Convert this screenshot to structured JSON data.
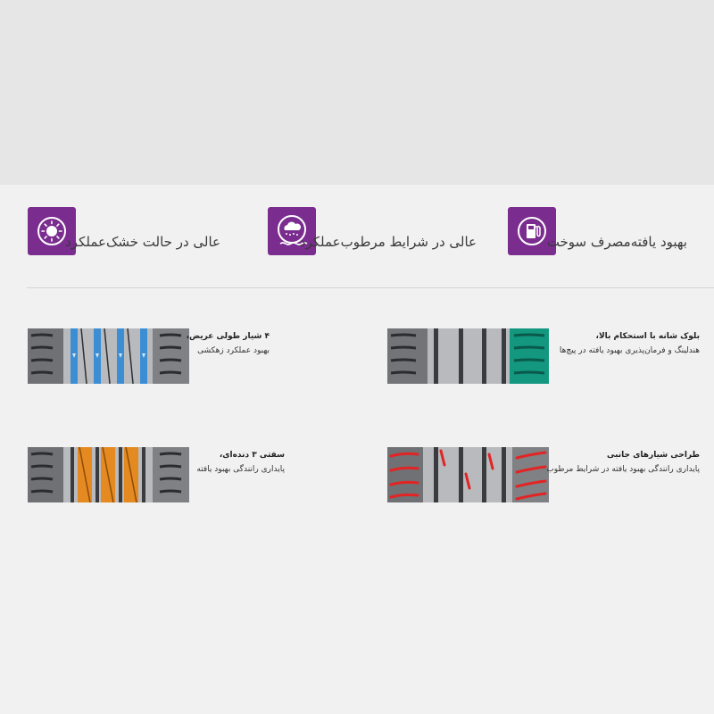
{
  "colors": {
    "accent": "#7a2d8f",
    "tire_base": "#7f8184",
    "highlight_blue": "#3b8ed4",
    "highlight_teal": "#13977f",
    "highlight_orange": "#e58a20",
    "highlight_red": "#e22424"
  },
  "features": [
    {
      "icon": "tire-sun-icon",
      "label": "عالی در حالت خشک‌عملکرد"
    },
    {
      "icon": "rain-cloud-icon",
      "label": "عالی در شرایط مرطوب‌عملکرد"
    },
    {
      "icon": "fuel-pump-icon",
      "label": "بهبود یافته‌مصرف سوخت"
    }
  ],
  "tread_items": [
    {
      "highlight": "blue-longitudinal-grooves",
      "title": "۴ شیار طولی عریض،",
      "text": "بهبود عملکرد زهکشی"
    },
    {
      "highlight": "teal-shoulder-blocks",
      "title": "بلوک شانه با استحکام بالا،",
      "text": "هندلینگ و فرمان‌پذیری بهبود یافته در پیچ‌ها"
    },
    {
      "highlight": "orange-ribs",
      "title": "سفتی ۳ دنده‌ای،",
      "text": "پایداری رانندگی بهبود یافته"
    },
    {
      "highlight": "red-lateral-grooves",
      "title": "طراحی شیارهای جانبی",
      "text": "پایداری رانندگی بهبود یافته در شرایط مرطوب"
    }
  ]
}
